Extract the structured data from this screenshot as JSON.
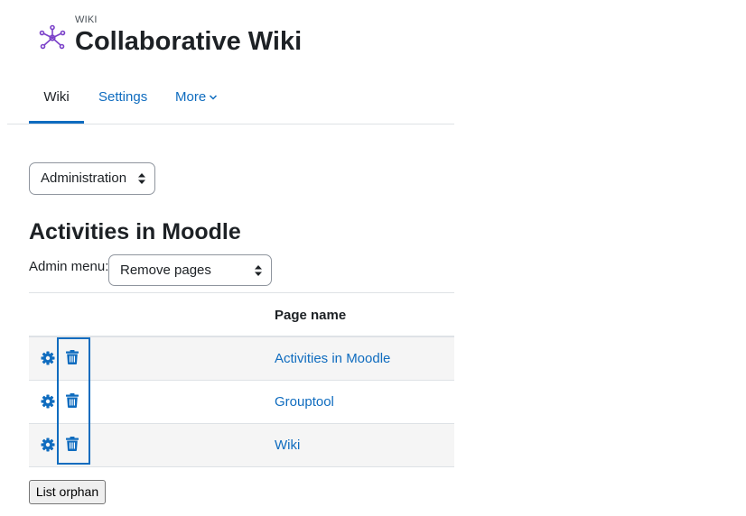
{
  "header": {
    "modname": "WIKI",
    "title": "Collaborative Wiki",
    "icon": "wiki-network-icon",
    "icon_color": "#7b41c9"
  },
  "tabs": [
    {
      "label": "Wiki",
      "active": true
    },
    {
      "label": "Settings",
      "active": false
    },
    {
      "label": "More",
      "active": false
    }
  ],
  "admin_select": {
    "value": "Administration"
  },
  "section_title": "Activities in Moodle",
  "admin_menu": {
    "label": "Admin menu:",
    "value": "Remove pages"
  },
  "table": {
    "header": "Page name",
    "rows": [
      {
        "name": "Activities in Moodle"
      },
      {
        "name": "Grouptool"
      },
      {
        "name": "Wiki"
      }
    ]
  },
  "list_orphan_button": "List orphan",
  "colors": {
    "link": "#0f6cbf",
    "highlight": "#0f6cbf",
    "text": "#1d2125"
  }
}
